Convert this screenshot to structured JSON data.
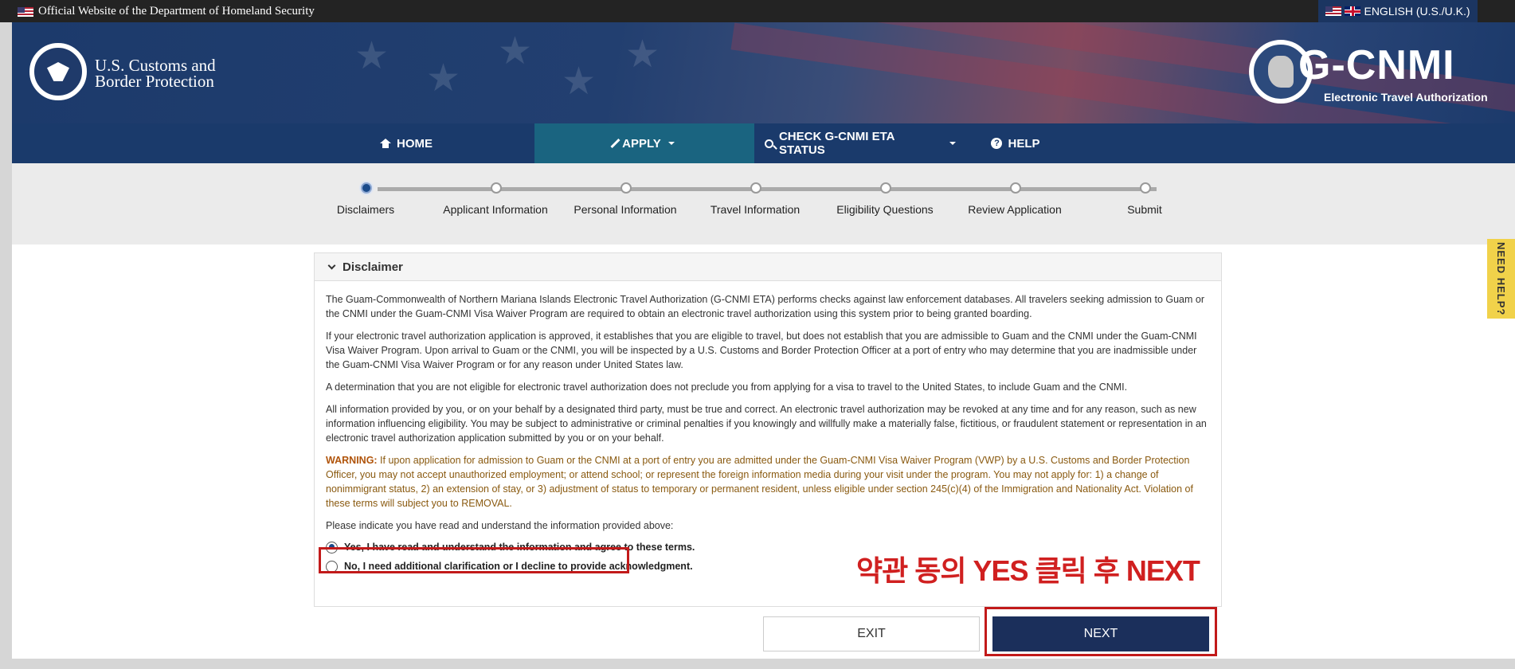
{
  "topbar": {
    "official_text": "Official Website of the Department of Homeland Security",
    "language": "ENGLISH (U.S./U.K.)"
  },
  "header": {
    "agency_line1": "U.S. Customs and",
    "agency_line2": "Border Protection",
    "eta_title": "G-CNMI",
    "eta_subtitle": "Electronic Travel Authorization"
  },
  "nav": {
    "home": "HOME",
    "apply": "APPLY",
    "check_status": "CHECK G-CNMI ETA STATUS",
    "help": "HELP"
  },
  "steps": [
    {
      "label": "Disclaimers",
      "current": true
    },
    {
      "label": "Applicant Information",
      "current": false
    },
    {
      "label": "Personal Information",
      "current": false
    },
    {
      "label": "Travel Information",
      "current": false
    },
    {
      "label": "Eligibility Questions",
      "current": false
    },
    {
      "label": "Review Application",
      "current": false
    },
    {
      "label": "Submit",
      "current": false
    }
  ],
  "disclaimer": {
    "title": "Disclaimer",
    "p1": "The Guam-Commonwealth of Northern Mariana Islands Electronic Travel Authorization (G-CNMI ETA) performs checks against law enforcement databases. All travelers seeking admission to Guam or the CNMI under the Guam-CNMI Visa Waiver Program are required to obtain an electronic travel authorization using this system prior to being granted boarding.",
    "p2": "If your electronic travel authorization application is approved, it establishes that you are eligible to travel, but does not establish that you are admissible to Guam and the CNMI under the Guam-CNMI Visa Waiver Program. Upon arrival to Guam or the CNMI, you will be inspected by a U.S. Customs and Border Protection Officer at a port of entry who may determine that you are inadmissible under the Guam-CNMI Visa Waiver Program or for any reason under United States law.",
    "p3": "A determination that you are not eligible for electronic travel authorization does not preclude you from applying for a visa to travel to the United States, to include Guam and the CNMI.",
    "p4": "All information provided by you, or on your behalf by a designated third party, must be true and correct. An electronic travel authorization may be revoked at any time and for any reason, such as new information influencing eligibility. You may be subject to administrative or criminal penalties if you knowingly and willfully make a materially false, fictitious, or fraudulent statement or representation in an electronic travel authorization application submitted by you or on your behalf.",
    "warning_label": "WARNING:",
    "warning_text": " If upon application for admission to Guam or the CNMI at a port of entry you are admitted under the Guam-CNMI Visa Waiver Program (VWP) by a U.S. Customs and Border Protection Officer, you may not accept unauthorized employment; or attend school; or represent the foreign information media during your visit under the program. You may not apply for: 1) a change of nonimmigrant status, 2) an extension of stay, or 3) adjustment of status to temporary or permanent resident, unless eligible under section 245(c)(4) of the Immigration and Nationality Act. Violation of these terms will subject you to REMOVAL.",
    "prompt": "Please indicate you have read and understand the information provided above:",
    "option_yes": "Yes, I have read and understand the information and agree to these terms.",
    "option_no": "No, I need additional clarification or I decline to provide acknowledgment.",
    "selected": "yes"
  },
  "annotation": "약관 동의 YES 클릭 후 NEXT",
  "buttons": {
    "exit": "EXIT",
    "next": "NEXT"
  },
  "need_help": "NEED HELP?",
  "colors": {
    "nav_bg": "#1a3a6b",
    "nav_active": "#1a6480",
    "next_btn": "#1b2f5b",
    "annotation_red": "#d02020",
    "need_help_bg": "#f1d24a"
  }
}
